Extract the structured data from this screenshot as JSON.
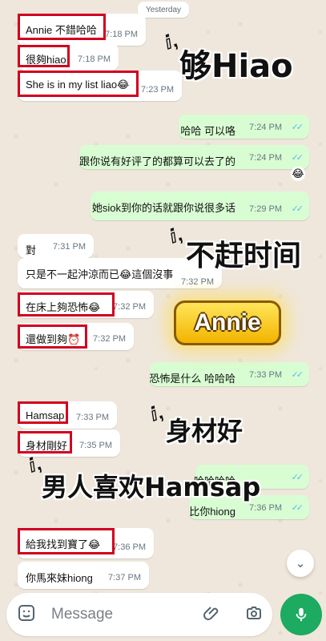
{
  "date_label": "Yesterday",
  "messages": [
    {
      "text": "Annie 不錯哈哈",
      "time": "7:18 PM"
    },
    {
      "text": "很夠hiao",
      "time": "7:18 PM"
    },
    {
      "text": "She is in my list liao😂",
      "time": "7:23 PM"
    },
    {
      "text": "哈哈 可以咯",
      "time": "7:24 PM"
    },
    {
      "text": "跟你说有好评了的都算可以去了的",
      "time": "7:24 PM"
    },
    {
      "text": "她siok到你的话就跟你说很多话",
      "time": "7:29 PM"
    },
    {
      "text": "對",
      "time": "7:31 PM"
    },
    {
      "text": "只是不一起沖涼而已😂這個沒事",
      "time": "7:32 PM"
    },
    {
      "text": "在床上夠恐怖😂",
      "time": "7:32 PM"
    },
    {
      "text": "還做到夠⏰",
      "time": "7:32 PM"
    },
    {
      "text": "恐怖是什么 哈哈哈",
      "time": "7:33 PM"
    },
    {
      "text": "Hamsap",
      "time": "7:33 PM"
    },
    {
      "text": "身材剛好",
      "time": "7:35 PM"
    },
    {
      "text": "哈哈哈哈",
      "time": ""
    },
    {
      "text": "比你hiong",
      "time": "7:36 PM"
    },
    {
      "text": "給我找到寶了😂",
      "time": "7:36 PM"
    },
    {
      "text": "你馬來妹hiong",
      "time": "7:37 PM"
    }
  ],
  "overlays": {
    "o1": "够Hiao",
    "o2": "不赶时间",
    "o3": "Annie",
    "o4": "身材好",
    "o5": "男人喜欢Hamsap"
  },
  "reaction_emoji": "😂",
  "input_placeholder": "Message",
  "colors": {
    "incoming": "#ffffff",
    "outgoing": "#d9fdd3",
    "mic": "#1daa61",
    "highlight": "#d1001f"
  }
}
